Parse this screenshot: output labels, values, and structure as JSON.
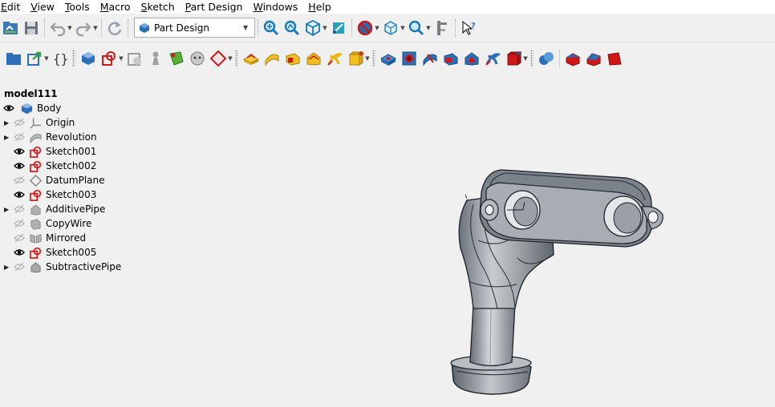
{
  "menu": [
    {
      "label": "Edit",
      "underline": "E"
    },
    {
      "label": "View",
      "underline": "V"
    },
    {
      "label": "Tools",
      "underline": "T"
    },
    {
      "label": "Macro",
      "underline": "M"
    },
    {
      "label": "Sketch",
      "underline": "S"
    },
    {
      "label": "Part Design",
      "underline": "P"
    },
    {
      "label": "Windows",
      "underline": "W"
    },
    {
      "label": "Help",
      "underline": "H"
    }
  ],
  "workbench": {
    "selected": "Part Design"
  },
  "tree": {
    "document": "model111",
    "body": "Body",
    "items": [
      {
        "label": "Origin",
        "expandable": true,
        "visible": false,
        "icon": "origin-icon"
      },
      {
        "label": "Revolution",
        "expandable": true,
        "visible": false,
        "icon": "revolution-icon"
      },
      {
        "label": "Sketch001",
        "expandable": false,
        "visible": true,
        "icon": "sketch-icon"
      },
      {
        "label": "Sketch002",
        "expandable": false,
        "visible": true,
        "icon": "sketch-icon"
      },
      {
        "label": "DatumPlane",
        "expandable": false,
        "visible": false,
        "icon": "datum-plane-icon"
      },
      {
        "label": "Sketch003",
        "expandable": false,
        "visible": true,
        "icon": "sketch-icon"
      },
      {
        "label": "AdditivePipe",
        "expandable": true,
        "visible": false,
        "icon": "additive-pipe-icon"
      },
      {
        "label": "CopyWire",
        "expandable": false,
        "visible": false,
        "icon": "copywire-icon"
      },
      {
        "label": "Mirrored",
        "expandable": false,
        "visible": false,
        "icon": "mirrored-icon"
      },
      {
        "label": "Sketch005",
        "expandable": false,
        "visible": true,
        "icon": "sketch-icon"
      },
      {
        "label": "SubtractivePipe",
        "expandable": true,
        "visible": false,
        "icon": "subtractive-pipe-icon"
      }
    ]
  },
  "colors": {
    "accent_blue": "#2c6fb6",
    "sketch_red": "#d01818",
    "pad_yellow": "#f0c020",
    "model_gray": "#a8adb3"
  }
}
